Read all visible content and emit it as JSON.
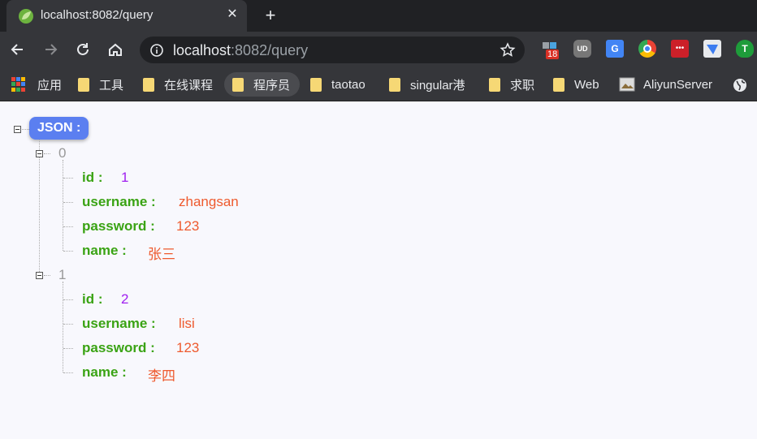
{
  "tab": {
    "title": "localhost:8082/query",
    "close": "✕",
    "new_tab": "+"
  },
  "omnibox": {
    "host": "localhost",
    "path": ":8082/query"
  },
  "extensions": [
    {
      "name": "puzzle-extension",
      "badge": "18",
      "color": "#4aa3df"
    },
    {
      "name": "ublock-extension",
      "label": "UD",
      "color": "#777"
    },
    {
      "name": "google-translate-extension",
      "label": "G",
      "color": "#4285f4"
    },
    {
      "name": "chrome-extension",
      "color": "#ea4335"
    },
    {
      "name": "lastpass-extension",
      "label": "•••",
      "color": "#cc2029"
    },
    {
      "name": "feishu-extension",
      "color": "#3c7cf0"
    },
    {
      "name": "tampermonkey-extension",
      "label": "T",
      "color": "#1e9c3a"
    }
  ],
  "bookmarks": [
    {
      "label": "应用",
      "type": "apps"
    },
    {
      "label": "工具",
      "type": "folder"
    },
    {
      "label": "在线课程",
      "type": "folder"
    },
    {
      "label": "程序员",
      "type": "folder"
    },
    {
      "label": "taotao",
      "type": "folder"
    },
    {
      "label": "singular港",
      "type": "folder"
    },
    {
      "label": "求职",
      "type": "folder"
    },
    {
      "label": "Web",
      "type": "folder"
    },
    {
      "label": "AliyunServer",
      "type": "image"
    }
  ],
  "json_view": {
    "root_label": "JSON :",
    "items": [
      {
        "index": "0",
        "fields": [
          {
            "key": "id :",
            "value": "1",
            "kind": "num"
          },
          {
            "key": "username :",
            "value": "zhangsan",
            "kind": "str"
          },
          {
            "key": "password :",
            "value": "123",
            "kind": "str"
          },
          {
            "key": "name :",
            "value": "张三",
            "kind": "str"
          }
        ]
      },
      {
        "index": "1",
        "fields": [
          {
            "key": "id :",
            "value": "2",
            "kind": "num"
          },
          {
            "key": "username :",
            "value": "lisi",
            "kind": "str"
          },
          {
            "key": "password :",
            "value": "123",
            "kind": "str"
          },
          {
            "key": "name :",
            "value": "李四",
            "kind": "str"
          }
        ]
      }
    ]
  }
}
